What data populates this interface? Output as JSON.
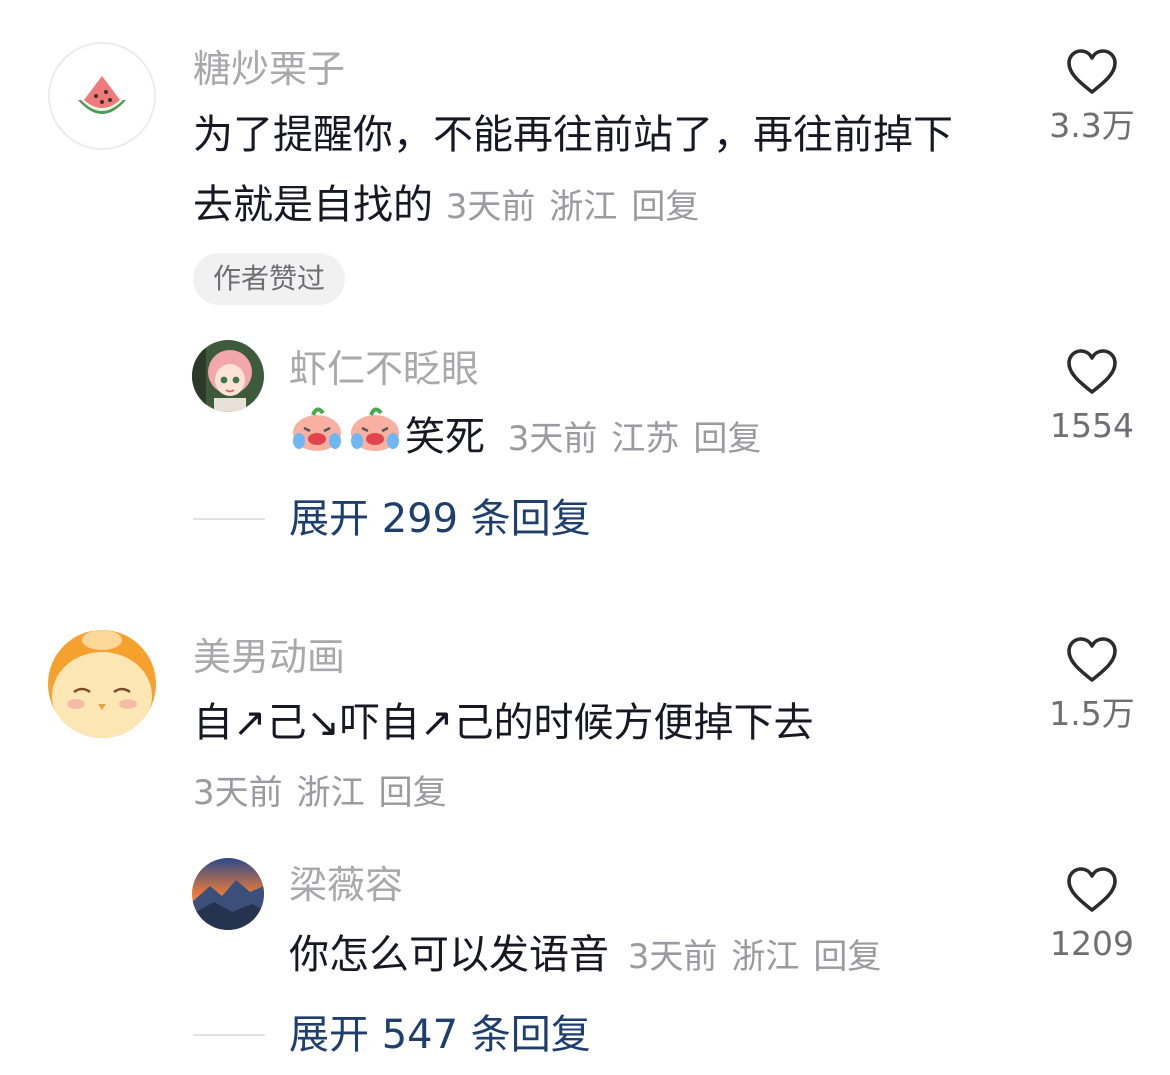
{
  "colors": {
    "username": "#a8a8ad",
    "content": "#161823",
    "meta": "#9a9aa0",
    "expand_link": "#1e3e6e",
    "badge_bg": "#f1f1f2"
  },
  "comments": [
    {
      "avatar_icon": "watermelon-avatar",
      "username": "糖炒栗子",
      "text_line1": "为了提醒你，不能再往前站了，再往前掉下",
      "text_line2": "去就是自找的",
      "time": "3天前",
      "location": "浙江",
      "reply_label": "回复",
      "like_icon": "heart-outline-icon",
      "like_count": "3.3万",
      "badge": "作者赞过",
      "replies": [
        {
          "avatar_icon": "anime-girl-avatar",
          "username": "虾仁不眨眼",
          "emoji": "crying-laughing-emoji",
          "text": "笑死",
          "time": "3天前",
          "location": "江苏",
          "reply_label": "回复",
          "like_count": "1554"
        }
      ],
      "expand_label": "展开 299 条回复"
    },
    {
      "avatar_icon": "chick-avatar",
      "username": "美男动画",
      "text": "自↗己↘吓自↗己的时候方便掉下去",
      "time": "3天前",
      "location": "浙江",
      "reply_label": "回复",
      "like_icon": "heart-outline-icon",
      "like_count": "1.5万",
      "replies": [
        {
          "avatar_icon": "mountain-sunset-avatar",
          "username": "梁薇容",
          "text": "你怎么可以发语音",
          "time": "3天前",
          "location": "浙江",
          "reply_label": "回复",
          "like_count": "1209"
        }
      ],
      "expand_label": "展开 547 条回复"
    }
  ]
}
